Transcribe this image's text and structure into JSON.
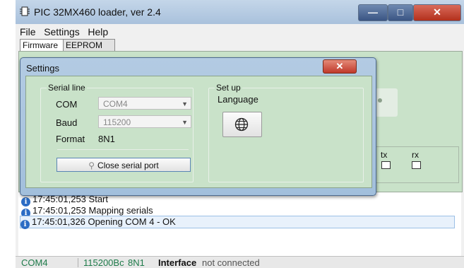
{
  "window": {
    "title": "PIC 32MX460 loader, ver 2.4",
    "controls": {
      "minimize": "—",
      "maximize": "□",
      "close": "✕"
    }
  },
  "menu": [
    "File",
    "Settings",
    "Help"
  ],
  "tabs": [
    "Firmware",
    "EEPROM"
  ],
  "indicators": {
    "tx": "tx",
    "rx": "rx"
  },
  "dialog": {
    "title": "Settings",
    "close": "✕",
    "serial_group": {
      "title": "Serial line",
      "com_label": "COM",
      "com_value": "COM4",
      "baud_label": "Baud",
      "baud_value": "115200",
      "format_label": "Format",
      "format_value": "8N1",
      "close_button": "Close serial port"
    },
    "setup_group": {
      "title": "Set up",
      "language_label": "Language"
    }
  },
  "log": [
    {
      "time": "17:45:01,253",
      "text": "Start"
    },
    {
      "time": "17:45:01,253",
      "text": "Mapping serials"
    },
    {
      "time": "17:45:01,326",
      "text": "Opening COM 4 - OK"
    }
  ],
  "status": {
    "port": "COM4",
    "baud": "115200Bc",
    "format": "8N1",
    "interface_label": "Interface",
    "interface_state": "not connected"
  }
}
